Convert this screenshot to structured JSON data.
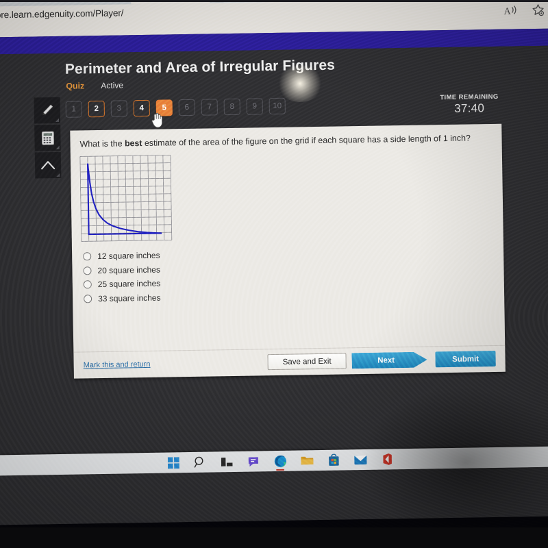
{
  "browser": {
    "url": ".core.learn.edgenuity.com/Player/",
    "icons": [
      {
        "name": "read-aloud-icon",
        "label": "A"
      },
      {
        "name": "favorites-star-gear-icon",
        "label": "star"
      }
    ]
  },
  "header": {
    "title": "Perimeter and Area of Irregular Figures",
    "activity_type": "Quiz",
    "status": "Active",
    "accent_color": "#e8833a",
    "brand_bar_color": "#2d1f9e"
  },
  "tools": [
    {
      "name": "pencil-tool",
      "icon": "pencil-icon"
    },
    {
      "name": "calculator-tool",
      "icon": "calculator-icon"
    },
    {
      "name": "collapse-tool",
      "icon": "chevron-up-icon"
    }
  ],
  "question_nav": {
    "items": [
      {
        "label": "1",
        "state": "unvisited"
      },
      {
        "label": "2",
        "state": "answered"
      },
      {
        "label": "3",
        "state": "unvisited"
      },
      {
        "label": "4",
        "state": "answered"
      },
      {
        "label": "5",
        "state": "current"
      },
      {
        "label": "6",
        "state": "unvisited"
      },
      {
        "label": "7",
        "state": "unvisited"
      },
      {
        "label": "8",
        "state": "unvisited"
      },
      {
        "label": "9",
        "state": "unvisited"
      },
      {
        "label": "10",
        "state": "unvisited"
      }
    ]
  },
  "timer": {
    "label": "TIME REMAINING",
    "value": "37:40"
  },
  "question": {
    "prefix": "What is the ",
    "emphasis": "best",
    "suffix": " estimate of the area of the figure on the grid if each square has a side length of 1 inch?"
  },
  "chart_data": {
    "type": "line",
    "title": "",
    "xlabel": "",
    "ylabel": "",
    "grid": true,
    "grid_cols": 12,
    "grid_rows": 11,
    "unit_label": "1 inch",
    "curve_color": "#2020c0",
    "grid_color": "#8d8d93",
    "description": "Irregular figure bounded by a decreasing hyperbolic curve, a vertical left edge and a horizontal bottom edge on a unit grid",
    "x": [
      1.0,
      1.1,
      1.25,
      1.45,
      1.7,
      2.0,
      2.4,
      2.9,
      3.5,
      4.3,
      5.2,
      6.3,
      7.5,
      8.7,
      9.8,
      10.6
    ],
    "y": [
      10.0,
      9.0,
      7.6,
      6.2,
      5.1,
      4.2,
      3.4,
      2.8,
      2.3,
      1.9,
      1.6,
      1.35,
      1.15,
      1.02,
      0.95,
      0.9
    ],
    "xlim": [
      0,
      12
    ],
    "ylim": [
      0,
      11
    ],
    "closing_edges": [
      {
        "name": "left-vertical-edge",
        "from": [
          1.0,
          10.0
        ],
        "to": [
          1.0,
          0.9
        ]
      },
      {
        "name": "bottom-horizontal-edge",
        "from": [
          1.0,
          0.9
        ],
        "to": [
          10.6,
          0.9
        ]
      }
    ]
  },
  "answers": {
    "options": [
      {
        "label": "12 square inches",
        "selected": false
      },
      {
        "label": "20 square inches",
        "selected": false
      },
      {
        "label": "25 square inches",
        "selected": false
      },
      {
        "label": "33 square inches",
        "selected": false
      }
    ]
  },
  "footer": {
    "mark_link": "Mark this and return",
    "save_exit": "Save and Exit",
    "next": "Next",
    "submit": "Submit",
    "button_color": "#2a91c6"
  },
  "taskbar": {
    "items": [
      {
        "name": "start-button",
        "icon": "windows-logo-icon",
        "active": false
      },
      {
        "name": "search-button",
        "icon": "search-icon",
        "active": false
      },
      {
        "name": "task-view-button",
        "icon": "task-view-icon",
        "active": false
      },
      {
        "name": "chat-button",
        "icon": "chat-bubble-icon",
        "active": false
      },
      {
        "name": "edge-button",
        "icon": "edge-browser-icon",
        "active": true
      },
      {
        "name": "file-explorer-button",
        "icon": "folder-icon",
        "active": false
      },
      {
        "name": "microsoft-store-button",
        "icon": "store-bag-icon",
        "active": false
      },
      {
        "name": "mail-button",
        "icon": "envelope-icon",
        "active": false
      },
      {
        "name": "office-button",
        "icon": "office-icon",
        "active": false
      }
    ]
  }
}
